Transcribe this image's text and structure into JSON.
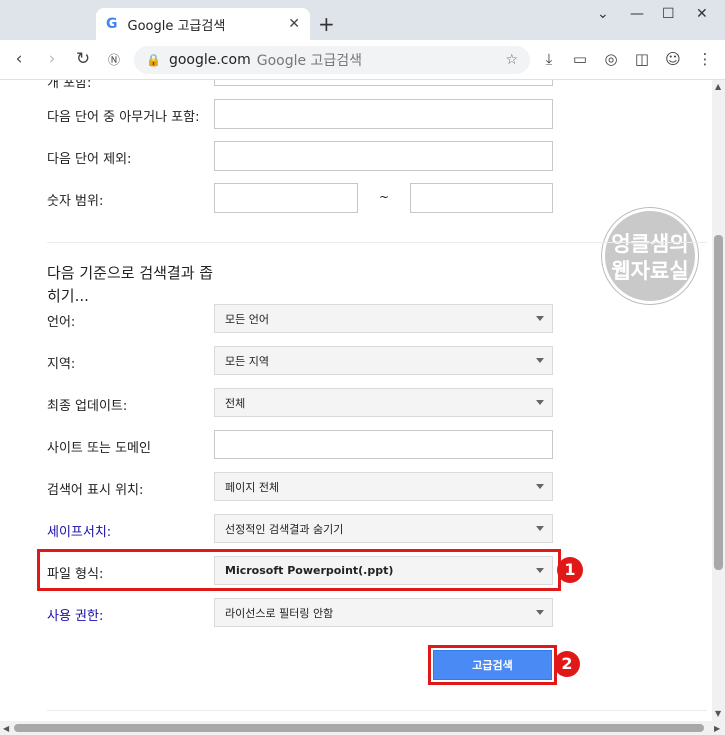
{
  "browser": {
    "tab_title": "Google 고급검색",
    "tab_favicon": "G",
    "new_tab": "+",
    "url_host": "google.com",
    "url_title": "Google 고급검색"
  },
  "form": {
    "prev_label": "개 포함:",
    "any_words_label": "다음 단어 중 아무거나 포함:",
    "exclude_label": "다음 단어 제외:",
    "number_range_label": "숫자 범위:",
    "range_sep": "~",
    "section_title": "다음 기준으로 검색결과 좁히기...",
    "language": {
      "label": "언어:",
      "value": "모든 언어"
    },
    "region": {
      "label": "지역:",
      "value": "모든 지역"
    },
    "last_update": {
      "label": "최종 업데이트:",
      "value": "전체"
    },
    "site_domain": {
      "label": "사이트 또는 도메인",
      "value": ""
    },
    "terms_appearing": {
      "label": "검색어 표시 위치:",
      "value": "페이지 전체"
    },
    "safesearch": {
      "label": "세이프서치:",
      "value": "선정적인 검색결과 숨기기"
    },
    "file_type": {
      "label": "파일 형식:",
      "value": "Microsoft Powerpoint(.ppt)"
    },
    "usage_rights": {
      "label": "사용 권한:",
      "value": "라이선스로 필터링 안함"
    },
    "submit_label": "고급검색"
  },
  "annotations": {
    "badge_1": "1",
    "badge_2": "2"
  },
  "watermark": {
    "line1": "엉클샘의",
    "line2": "웹자료실"
  },
  "colors": {
    "accent": "#4a8af4",
    "highlight": "#e01818",
    "link_label": "#1a0dab"
  }
}
